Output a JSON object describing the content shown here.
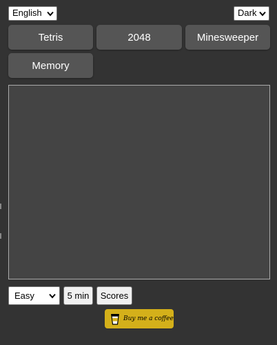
{
  "settings": {
    "language": "English",
    "theme": "Dark"
  },
  "games": [
    {
      "label": "Tetris"
    },
    {
      "label": "2048"
    },
    {
      "label": "Minesweeper"
    },
    {
      "label": "Memory"
    }
  ],
  "controls": {
    "difficulty": "Easy",
    "timer_label": "5 min",
    "scores_label": "Scores"
  },
  "donate": {
    "label": "Buy me a coffee"
  },
  "icons": {
    "dropdown": "chevron-down-icon",
    "coffee": "coffee-cup-icon"
  },
  "colors": {
    "background": "#333333",
    "game_button": "#555555",
    "board": "#444444",
    "coffee_button": "#d4b01a"
  }
}
